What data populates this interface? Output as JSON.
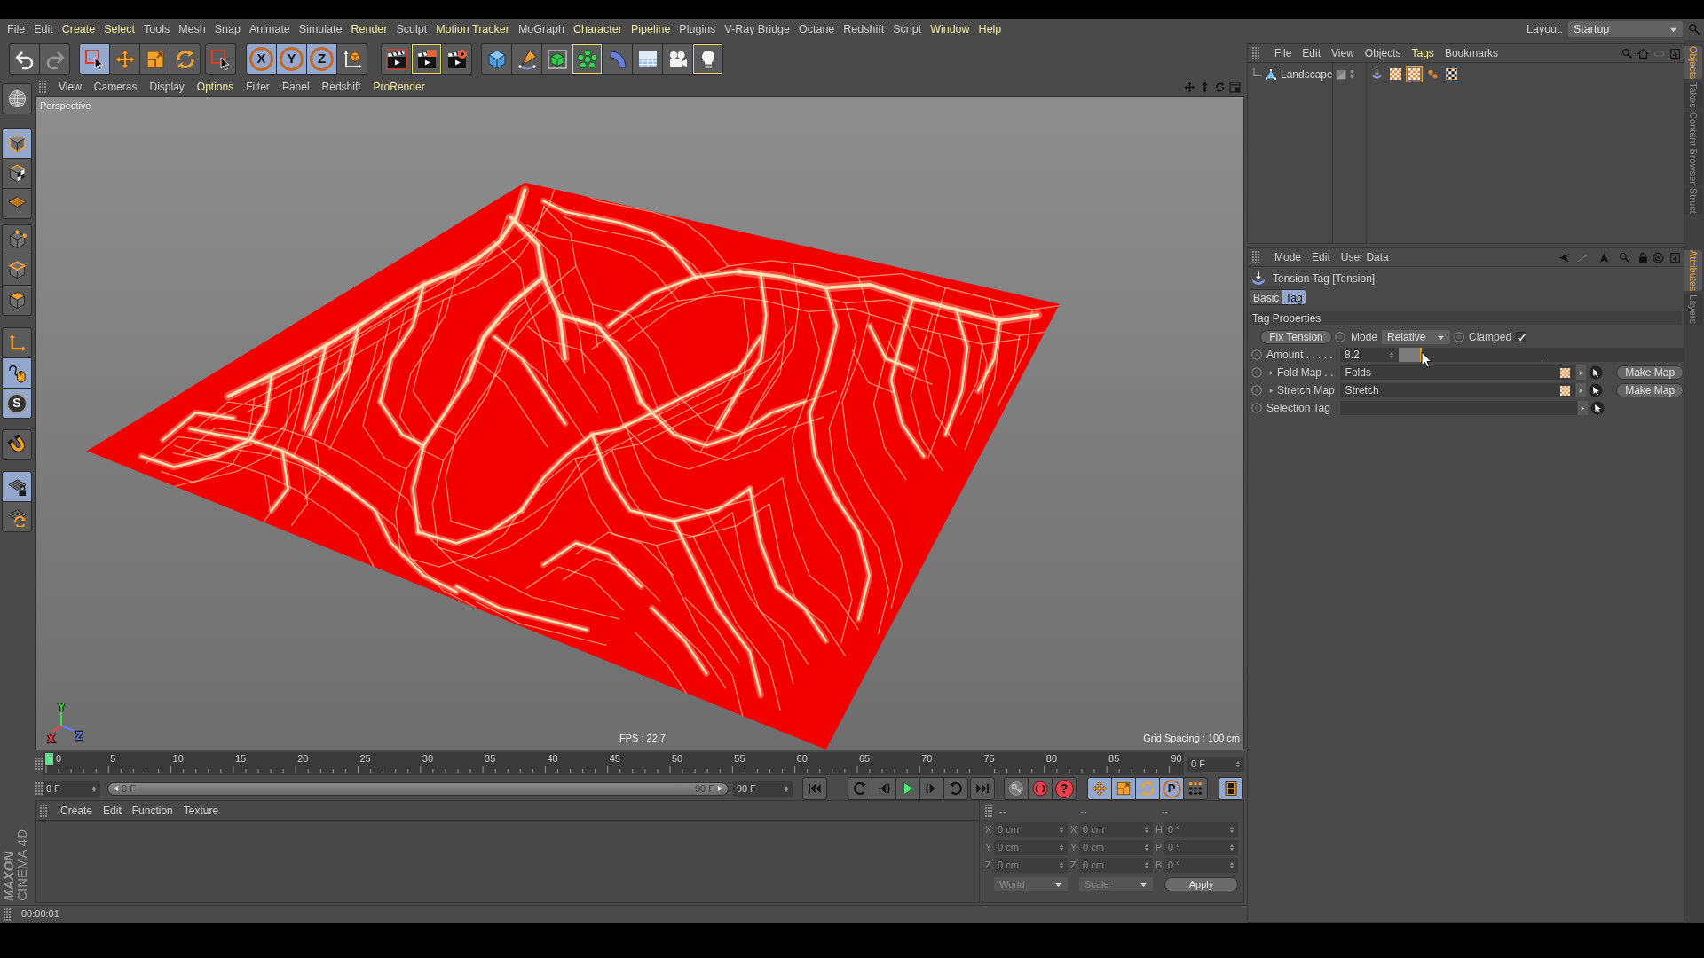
{
  "menu_bar": [
    {
      "label": "File",
      "highlighted": false
    },
    {
      "label": "Edit",
      "highlighted": false
    },
    {
      "label": "Create",
      "highlighted": true
    },
    {
      "label": "Select",
      "highlighted": true
    },
    {
      "label": "Tools",
      "highlighted": false
    },
    {
      "label": "Mesh",
      "highlighted": false
    },
    {
      "label": "Snap",
      "highlighted": false
    },
    {
      "label": "Animate",
      "highlighted": false
    },
    {
      "label": "Simulate",
      "highlighted": false
    },
    {
      "label": "Render",
      "highlighted": true
    },
    {
      "label": "Sculpt",
      "highlighted": false
    },
    {
      "label": "Motion Tracker",
      "highlighted": true
    },
    {
      "label": "MoGraph",
      "highlighted": false
    },
    {
      "label": "Character",
      "highlighted": true
    },
    {
      "label": "Pipeline",
      "highlighted": true
    },
    {
      "label": "Plugins",
      "highlighted": false
    },
    {
      "label": "V-Ray Bridge",
      "highlighted": false
    },
    {
      "label": "Octane",
      "highlighted": false
    },
    {
      "label": "Redshift",
      "highlighted": false
    },
    {
      "label": "Script",
      "highlighted": false
    },
    {
      "label": "Window",
      "highlighted": true
    },
    {
      "label": "Help",
      "highlighted": true
    }
  ],
  "layout": {
    "label": "Layout:",
    "value": "Startup"
  },
  "toolbar": [
    [
      {
        "kind": "undo",
        "selected": false,
        "highlighted": false,
        "disabled": false
      },
      {
        "kind": "redo",
        "selected": false,
        "highlighted": false,
        "disabled": true
      }
    ],
    [
      {
        "kind": "select",
        "selected": true,
        "highlighted": false,
        "disabled": false
      },
      {
        "kind": "move",
        "selected": false,
        "highlighted": false,
        "disabled": false
      },
      {
        "kind": "scale",
        "selected": false,
        "highlighted": false,
        "disabled": false
      },
      {
        "kind": "rotate",
        "selected": false,
        "highlighted": false,
        "disabled": false
      }
    ],
    [
      {
        "kind": "select",
        "selected": false,
        "highlighted": false,
        "disabled": false
      }
    ],
    [
      {
        "kind": "axis",
        "label": "X",
        "selected": true,
        "highlighted": false,
        "disabled": false
      },
      {
        "kind": "axis",
        "label": "Y",
        "selected": true,
        "highlighted": false,
        "disabled": false
      },
      {
        "kind": "axis",
        "label": "Z",
        "selected": true,
        "highlighted": false,
        "disabled": false
      },
      {
        "kind": "coordinates",
        "selected": false,
        "highlighted": false,
        "disabled": false
      }
    ],
    [
      {
        "kind": "renderview",
        "selected": false,
        "highlighted": false,
        "disabled": false
      },
      {
        "kind": "render",
        "selected": false,
        "highlighted": true,
        "disabled": false
      },
      {
        "kind": "rendersettings",
        "selected": false,
        "highlighted": false,
        "disabled": false
      }
    ],
    [
      {
        "kind": "cube",
        "selected": false,
        "highlighted": false,
        "disabled": false
      },
      {
        "kind": "pen",
        "selected": false,
        "highlighted": false,
        "disabled": false
      },
      {
        "kind": "subdivision",
        "selected": false,
        "highlighted": false,
        "disabled": false
      },
      {
        "kind": "cloner",
        "selected": false,
        "highlighted": true,
        "disabled": false
      },
      {
        "kind": "bend",
        "selected": false,
        "highlighted": false,
        "disabled": false
      },
      {
        "kind": "floor",
        "selected": false,
        "highlighted": false,
        "disabled": false
      },
      {
        "kind": "camera",
        "selected": false,
        "highlighted": false,
        "disabled": false
      },
      {
        "kind": "light",
        "selected": false,
        "highlighted": true,
        "disabled": false
      }
    ]
  ],
  "tool_palette": [
    [
      {
        "kind": "editable",
        "selected": false
      }
    ],
    [
      {
        "kind": "model",
        "selected": true
      },
      {
        "kind": "texture",
        "selected": false
      },
      {
        "kind": "workplane",
        "selected": false
      }
    ],
    [
      {
        "kind": "points",
        "selected": false
      },
      {
        "kind": "edges",
        "selected": false
      },
      {
        "kind": "polygons",
        "selected": false
      }
    ],
    [
      {
        "kind": "axismode",
        "selected": false
      },
      {
        "kind": "tweak",
        "selected": true
      },
      {
        "kind": "solo",
        "label": "S",
        "selected": true
      }
    ],
    [
      {
        "kind": "snap",
        "selected": false
      }
    ],
    [
      {
        "kind": "lockedplane",
        "selected": true
      },
      {
        "kind": "planarplane",
        "selected": false
      }
    ]
  ],
  "viewport": {
    "menu": [
      {
        "label": "View",
        "highlighted": false
      },
      {
        "label": "Cameras",
        "highlighted": false
      },
      {
        "label": "Display",
        "highlighted": false
      },
      {
        "label": "Options",
        "highlighted": true
      },
      {
        "label": "Filter",
        "highlighted": false
      },
      {
        "label": "Panel",
        "highlighted": false
      },
      {
        "label": "Redshift",
        "highlighted": false
      },
      {
        "label": "ProRender",
        "highlighted": true
      }
    ],
    "camera": "Perspective",
    "fps": "FPS : 22.7",
    "grid_spacing": "Grid Spacing : 100 cm",
    "axis_gizmo": [
      {
        "label": "X",
        "color": "#ff4040"
      },
      {
        "label": "Y",
        "color": "#40e040"
      },
      {
        "label": "Z",
        "color": "#6080ff"
      }
    ]
  },
  "timeline": {
    "labels": [
      "0",
      "5",
      "10",
      "15",
      "20",
      "25",
      "30",
      "35",
      "40",
      "45",
      "50",
      "55",
      "60",
      "65",
      "70",
      "75",
      "80",
      "85",
      "90"
    ],
    "level": 0,
    "current_frame": "0 F"
  },
  "frame_range": {
    "start_field": "0 F",
    "range_start": "0 F",
    "range_end": "90 F",
    "level": 1,
    "end_field": "90 F"
  },
  "transport": [
    [
      {
        "kind": "start",
        "selected": false
      }
    ],
    [
      {
        "kind": "prevkey",
        "selected": false
      },
      {
        "kind": "stepback",
        "selected": false
      },
      {
        "kind": "play",
        "selected": false
      },
      {
        "kind": "stepforward",
        "selected": false
      },
      {
        "kind": "nextkey",
        "selected": false
      }
    ],
    [
      {
        "kind": "end",
        "selected": false
      }
    ],
    [
      {
        "kind": "keys",
        "selected": false
      },
      {
        "kind": "autokey",
        "selected": false
      },
      {
        "kind": "keysel",
        "label": "?",
        "selected": false
      }
    ],
    [
      {
        "kind": "position",
        "selected": true
      },
      {
        "kind": "scaling",
        "selected": true
      },
      {
        "kind": "rotation",
        "selected": true
      },
      {
        "kind": "parameter",
        "label": "P",
        "selected": true
      },
      {
        "kind": "pointlevel",
        "selected": false
      }
    ],
    [
      {
        "kind": "scheme",
        "selected": true
      }
    ]
  ],
  "material_manager": {
    "menu": [
      "Create",
      "Edit",
      "Function",
      "Texture"
    ]
  },
  "coordinates": {
    "disabled": true,
    "headers": [
      "--",
      "--",
      "--"
    ],
    "rows": [
      [
        {
          "axis": "X",
          "value": "0 cm"
        },
        {
          "axis": "X",
          "value": "0 cm"
        },
        {
          "axis": "H",
          "value": "0 °"
        }
      ],
      [
        {
          "axis": "Y",
          "value": "0 cm"
        },
        {
          "axis": "Y",
          "value": "0 cm"
        },
        {
          "axis": "P",
          "value": "0 °"
        }
      ],
      [
        {
          "axis": "Z",
          "value": "0 cm"
        },
        {
          "axis": "Z",
          "value": "0 cm"
        },
        {
          "axis": "B",
          "value": "0 °"
        }
      ]
    ],
    "dropdowns": [
      "World",
      "Scale"
    ],
    "apply": "Apply"
  },
  "logo": {
    "brand": "MAXON",
    "product": "CINEMA 4D"
  },
  "status_bar": "00:00:01",
  "object_manager": {
    "menu": [
      {
        "label": "File",
        "highlighted": false
      },
      {
        "label": "Edit",
        "highlighted": false
      },
      {
        "label": "View",
        "highlighted": false
      },
      {
        "label": "Objects",
        "highlighted": false
      },
      {
        "label": "Tags",
        "highlighted": true
      },
      {
        "label": "Bookmarks",
        "highlighted": false
      }
    ],
    "objects": [
      {
        "name": "Landscape",
        "tags": [
          {
            "kind": "tension",
            "selected": false
          },
          {
            "kind": "material",
            "selected": false
          },
          {
            "kind": "material",
            "selected": true
          },
          {
            "kind": "spheres",
            "selected": false
          },
          {
            "kind": "texture",
            "selected": false
          }
        ]
      }
    ]
  },
  "attributes": {
    "menu": [
      "Mode",
      "Edit",
      "User Data"
    ],
    "title": "Tension Tag [Tension]",
    "tabs": [
      {
        "label": "Basic",
        "selected": false
      },
      {
        "label": "Tag",
        "selected": true
      }
    ],
    "section": "Tag Properties",
    "fix_button": "Fix Tension",
    "mode": {
      "label": "Mode",
      "value": "Relative"
    },
    "clamped": {
      "label": "Clamped",
      "checked": true
    },
    "amount": {
      "label": "Amount . . . . .",
      "value": "8.2",
      "level": 0.08
    },
    "links": [
      {
        "kind": "map",
        "label": "Fold Map . .",
        "value": "Folds",
        "button": "Make Map"
      },
      {
        "kind": "map",
        "label": "Stretch Map",
        "value": "Stretch",
        "button": "Make Map"
      },
      {
        "kind": "tag",
        "label": "Selection Tag"
      }
    ]
  },
  "dock_tabs": [
    [
      {
        "label": "Objects",
        "selected": true
      },
      {
        "label": "Takes",
        "selected": false
      },
      {
        "label": "Content Browser",
        "selected": false
      },
      {
        "label": "Struct",
        "selected": false
      }
    ],
    [
      {
        "label": "Attributes",
        "selected": true
      },
      {
        "label": "Layers",
        "selected": false
      }
    ]
  ]
}
